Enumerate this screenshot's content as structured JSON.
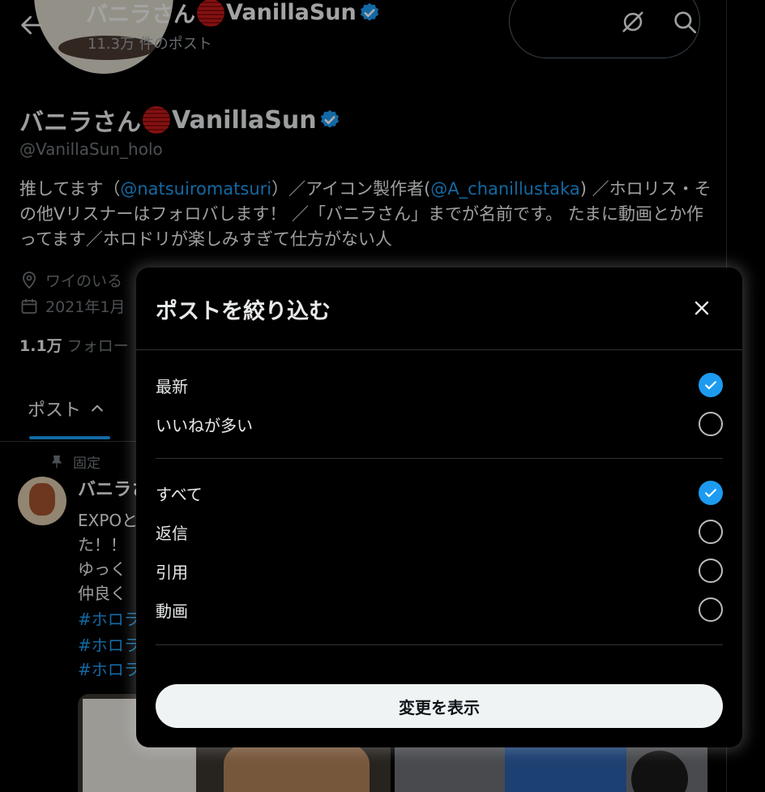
{
  "header": {
    "display_name_prefix": "バニラさん",
    "display_name_suffix": "VanillaSun",
    "post_count": "11.3万 件のポスト"
  },
  "profile": {
    "display_name_prefix": "バニラさん",
    "display_name_suffix": "VanillaSun",
    "handle": "@VanillaSun_holo",
    "bio_1": "推してます（",
    "bio_link1": "@natsuiromatsuri",
    "bio_2": "）／アイコン製作者(",
    "bio_link2": "@A_chanillustaka",
    "bio_3": ") ／ホロリス・その他Vリスナーはフォロバします！ ／「バニラさん」までが名前です。 たまに動画とか作ってます／ホロドリが楽しみすぎて仕方がない人",
    "location": "ワイのいる",
    "joined": "2021年1月",
    "following_count": "1.1万",
    "following_label": "フォロー"
  },
  "tabs": {
    "posts": "ポスト"
  },
  "pinned_post": {
    "pinned_label": "固定",
    "author": "バニラさ",
    "lines": [
      "EXPOと",
      "た！！",
      "ゆっく",
      "仲良く"
    ],
    "tags": [
      "#ホロラ",
      "#ホロラ",
      "#ホロラ"
    ]
  },
  "modal": {
    "title": "ポストを絞り込む",
    "sort_options": [
      {
        "label": "最新",
        "checked": true
      },
      {
        "label": "いいねが多い",
        "checked": false
      }
    ],
    "type_options": [
      {
        "label": "すべて",
        "checked": true
      },
      {
        "label": "返信",
        "checked": false
      },
      {
        "label": "引用",
        "checked": false
      },
      {
        "label": "動画",
        "checked": false
      }
    ],
    "apply_label": "変更を表示"
  },
  "icons": {
    "back": "back-arrow-icon",
    "no-notifications": "bell-slash-icon",
    "search": "search-icon",
    "verified": "verified-badge-icon",
    "location": "location-pin-icon",
    "calendar": "calendar-icon",
    "pin": "pin-icon",
    "close": "close-icon",
    "check": "checkmark-icon"
  },
  "colors": {
    "background": "#000000",
    "accent": "#1d9bf0",
    "text_primary": "#e7e9ea",
    "text_secondary": "#71767b",
    "apply_button_bg": "#eff3f4"
  }
}
